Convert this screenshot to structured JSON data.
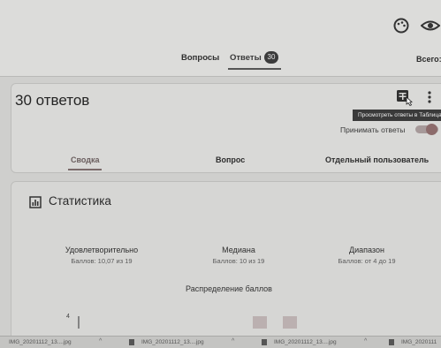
{
  "header": {
    "nav_questions": "Вопросы",
    "nav_answers": "Ответы",
    "answers_badge": "30",
    "total_label": "Всего:"
  },
  "responses": {
    "title": "30 ответов",
    "tooltip": "Просмотреть ответы в Таблицах",
    "accept_label": "Принимать ответы"
  },
  "tabs": {
    "summary": "Сводка",
    "question": "Вопрос",
    "individual": "Отдельный пользователь"
  },
  "stats": {
    "title": "Статистика",
    "metrics": [
      {
        "name": "Удовлетворительно",
        "value": "Баллов: 10,07 из 19"
      },
      {
        "name": "Медиана",
        "value": "Баллов: 10 из 19"
      },
      {
        "name": "Диапазон",
        "value": "Баллов: от 4 до 19"
      }
    ],
    "distribution_title": "Распределение баллов"
  },
  "chart_data": {
    "type": "bar",
    "yticks": [
      "4"
    ]
  },
  "taskbar": {
    "downloads": [
      "IMG_20201112_13....jpg",
      "IMG_20201112_13....jpg",
      "IMG_20201112_13....jpg",
      "IMG_2020111"
    ]
  },
  "colors": {
    "accent": "#6a5e5e",
    "toggle": "#8c6b6b",
    "badge": "#3b3b3b"
  },
  "icons": [
    "palette-icon",
    "eye-icon",
    "add-to-sheets-icon",
    "more-vert-icon",
    "bar-chart-icon",
    "file-icon",
    "chevron-up-icon"
  ]
}
